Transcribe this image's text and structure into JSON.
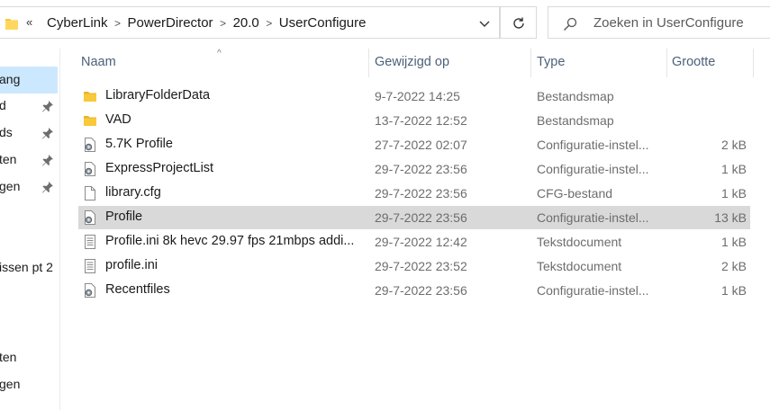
{
  "address": {
    "overflow_glyph": "«",
    "crumbs": [
      "CyberLink",
      "PowerDirector",
      "20.0",
      "UserConfigure"
    ]
  },
  "search": {
    "placeholder": "Zoeken in UserConfigure"
  },
  "nav": {
    "items": [
      {
        "label": "ang"
      },
      {
        "label": "d"
      },
      {
        "label": "ds"
      },
      {
        "label": "ten"
      },
      {
        "label": "gen"
      },
      {
        "label": "issen pt 2"
      },
      {
        "label": "ten"
      },
      {
        "label": "gen"
      }
    ]
  },
  "columns": {
    "name": "Naam",
    "modified": "Gewijzigd op",
    "type": "Type",
    "size": "Grootte",
    "sort_indicator": "^"
  },
  "files": [
    {
      "name": "LibraryFolderData",
      "modified": "9-7-2022 14:25",
      "type": "Bestandsmap",
      "size": "",
      "icon": "folder-icon"
    },
    {
      "name": "VAD",
      "modified": "13-7-2022 12:52",
      "type": "Bestandsmap",
      "size": "",
      "icon": "folder-icon"
    },
    {
      "name": "5.7K Profile",
      "modified": "27-7-2022 02:07",
      "type": "Configuratie-instel...",
      "size": "2 kB",
      "icon": "config-file-icon"
    },
    {
      "name": "ExpressProjectList",
      "modified": "29-7-2022 23:56",
      "type": "Configuratie-instel...",
      "size": "1 kB",
      "icon": "config-file-icon"
    },
    {
      "name": "library.cfg",
      "modified": "29-7-2022 23:56",
      "type": "CFG-bestand",
      "size": "1 kB",
      "icon": "blank-file-icon"
    },
    {
      "name": "Profile",
      "modified": "29-7-2022 23:56",
      "type": "Configuratie-instel...",
      "size": "13 kB",
      "icon": "config-file-icon"
    },
    {
      "name": "Profile.ini 8k hevc 29.97 fps 21mbps addi...",
      "modified": "29-7-2022 12:42",
      "type": "Tekstdocument",
      "size": "1 kB",
      "icon": "text-file-icon"
    },
    {
      "name": "profile.ini",
      "modified": "29-7-2022 23:52",
      "type": "Tekstdocument",
      "size": "2 kB",
      "icon": "text-file-icon"
    },
    {
      "name": "Recentfiles",
      "modified": "29-7-2022 23:56",
      "type": "Configuratie-instel...",
      "size": "1 kB",
      "icon": "config-file-icon"
    }
  ],
  "colors": {
    "selected_row": "#d9d9d9",
    "nav_selected": "#cce8ff",
    "folder": "#f8c93a",
    "header_text": "#4c607a"
  }
}
